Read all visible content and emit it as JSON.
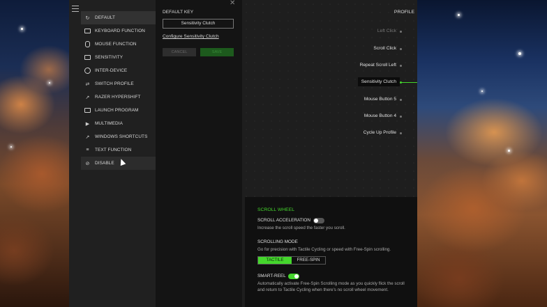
{
  "sidebar": {
    "items": [
      {
        "label": "DEFAULT",
        "icon": "refresh-icon"
      },
      {
        "label": "KEYBOARD FUNCTION",
        "icon": "keyboard-icon"
      },
      {
        "label": "MOUSE FUNCTION",
        "icon": "mouse-icon"
      },
      {
        "label": "SENSITIVITY",
        "icon": "sensitivity-icon"
      },
      {
        "label": "INTER-DEVICE",
        "icon": "inter-device-icon"
      },
      {
        "label": "SWITCH PROFILE",
        "icon": "switch-profile-icon"
      },
      {
        "label": "RAZER HYPERSHIFT",
        "icon": "hypershift-icon"
      },
      {
        "label": "LAUNCH PROGRAM",
        "icon": "launch-icon"
      },
      {
        "label": "MULTIMEDIA",
        "icon": "multimedia-icon"
      },
      {
        "label": "WINDOWS SHORTCUTS",
        "icon": "shortcut-icon"
      },
      {
        "label": "TEXT FUNCTION",
        "icon": "text-icon"
      },
      {
        "label": "DISABLE",
        "icon": "disable-icon"
      }
    ]
  },
  "panel": {
    "title": "DEFAULT KEY",
    "key_value": "Sensitivity Clutch",
    "config_link": "Configure Sensitivity Clutch",
    "cancel_label": "CANCEL",
    "save_label": "SAVE"
  },
  "main": {
    "profile_label": "PROFILE",
    "buttons": [
      "Left Click",
      "Scroll Click",
      "Repeat Scroll Left",
      "Sensitivity Clutch",
      "Mouse Button 5",
      "Mouse Button 4",
      "Cycle Up Profile"
    ]
  },
  "scroll_wheel": {
    "title": "SCROLL WHEEL",
    "accel_label": "SCROLL ACCELERATION",
    "accel_desc": "Increase the scroll speed the faster you scroll.",
    "mode_label": "SCROLLING MODE",
    "mode_desc": "Go for precision with Tactile Cycling or speed with Free-Spin scrolling.",
    "mode_options": [
      "TACTILE",
      "FREE-SPIN"
    ],
    "smart_label": "SMART-REEL",
    "smart_desc_1": "Automatically activate Free-Spin Scrolling mode as you quickly flick the scroll",
    "smart_desc_2": "and return to Tactile Cycling when there's no scroll wheel movement."
  },
  "colors": {
    "accent": "#44d62c",
    "background": "#1b1b1b"
  }
}
